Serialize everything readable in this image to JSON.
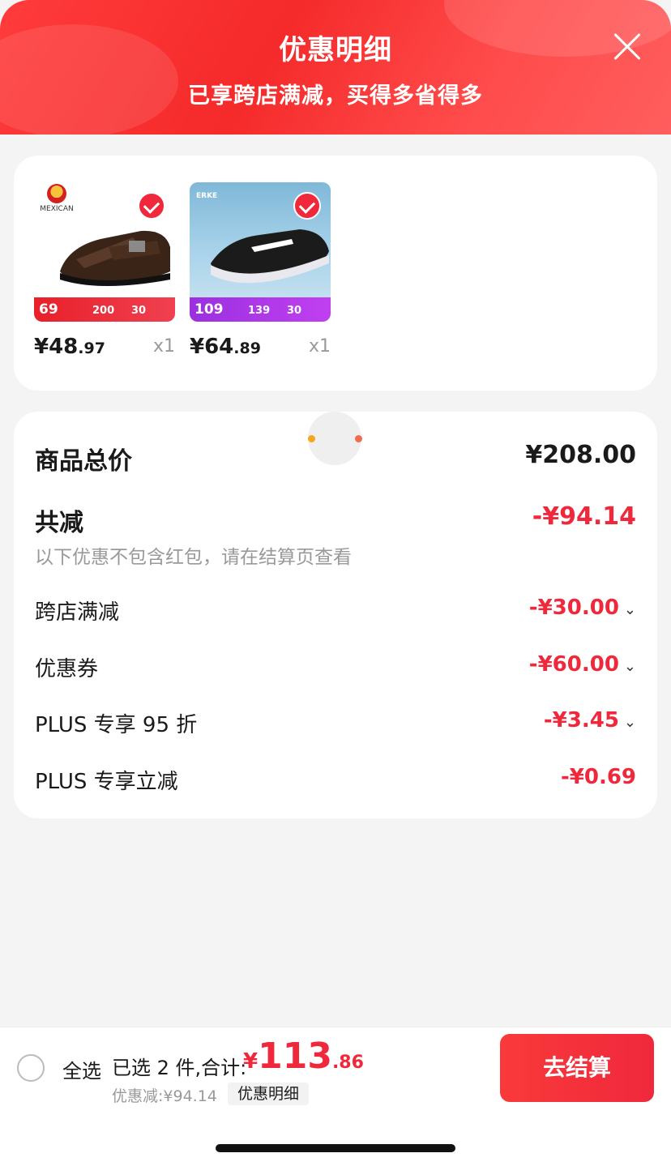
{
  "header": {
    "title": "优惠明细",
    "subtitle": "已享跨店满减，买得多省得多"
  },
  "products": [
    {
      "brand": "MEXICAN",
      "price_int": "¥48",
      "price_dec": ".97",
      "qty": "x1",
      "promo_price": "69",
      "promo_mid": "200",
      "promo_right": "30"
    },
    {
      "brand": "ERKE",
      "price_int": "¥64",
      "price_dec": ".89",
      "qty": "x1",
      "promo_price": "109",
      "promo_mid": "139",
      "promo_right": "30"
    }
  ],
  "summary": {
    "total_label": "商品总价",
    "total_value": "¥208.00",
    "reduce_label": "共减",
    "reduce_value": "-¥94.14",
    "note": "以下优惠不包含红包，请在结算页查看",
    "items": [
      {
        "label": "跨店满减",
        "value": "-¥30.00",
        "chevron": "chevron-down"
      },
      {
        "label": "优惠券",
        "value": "-¥60.00",
        "chevron": "chevron-down"
      },
      {
        "label": "PLUS 专享 95 折",
        "value": "-¥3.45",
        "chevron": "chevron-down"
      },
      {
        "label": "PLUS 专享立减",
        "value": "-¥0.69"
      }
    ]
  },
  "footer": {
    "select_all": "全选",
    "selected_text": "已选 2 件,合计:",
    "amount_currency": "¥",
    "amount_int": "113",
    "amount_dec": ".86",
    "discount_line": "优惠减:¥94.14",
    "detail_tag": "优惠明细",
    "checkout": "去结算"
  },
  "colors": {
    "accent_red": "#f0283c",
    "header_red": "#f52a2a"
  }
}
